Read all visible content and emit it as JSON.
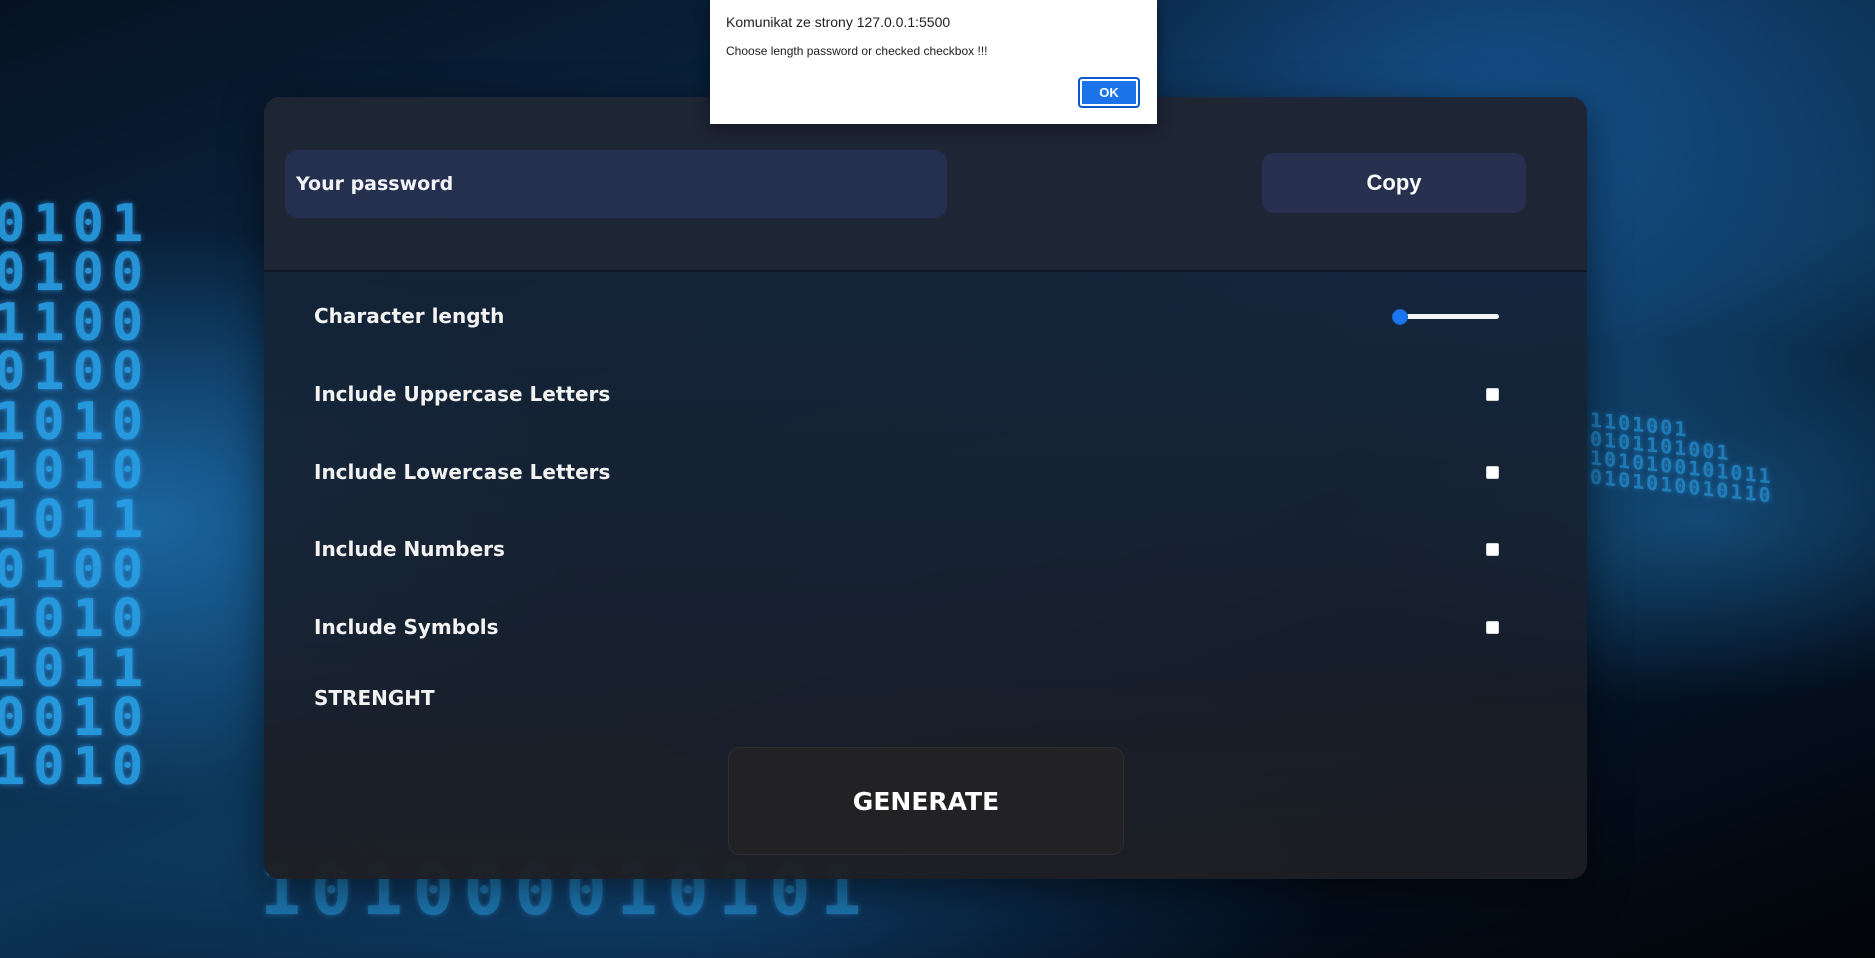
{
  "generator": {
    "password_display": "Your password",
    "copy_label": "Copy",
    "options": [
      {
        "label": "Character length",
        "control": "slider",
        "value": 0
      },
      {
        "label": "Include Uppercase Letters",
        "control": "checkbox",
        "checked": false
      },
      {
        "label": "Include Lowercase Letters",
        "control": "checkbox",
        "checked": false
      },
      {
        "label": "Include Numbers",
        "control": "checkbox",
        "checked": false
      },
      {
        "label": "Include Symbols",
        "control": "checkbox",
        "checked": false
      }
    ],
    "strength_label": "STRENGHT",
    "generate_label": "GENERATE"
  },
  "alert": {
    "title": "Komunikat ze strony 127.0.0.1:5500",
    "message": "Choose length password or checked checkbox !!!",
    "ok_label": "OK"
  },
  "colors": {
    "slider_accent": "#1976f0",
    "ok_button": "#1a73e8"
  }
}
